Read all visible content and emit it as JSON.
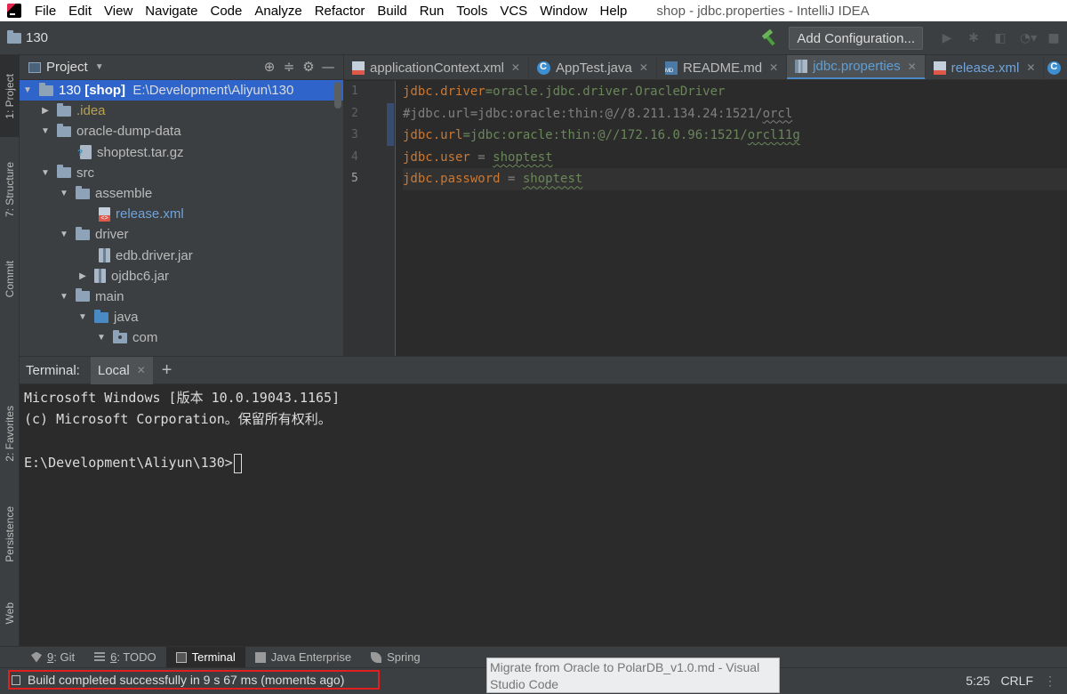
{
  "menubar": {
    "items": [
      "File",
      "Edit",
      "View",
      "Navigate",
      "Code",
      "Analyze",
      "Refactor",
      "Build",
      "Run",
      "Tools",
      "VCS",
      "Window",
      "Help"
    ],
    "window_title": "shop - jdbc.properties - IntelliJ IDEA"
  },
  "toolbar": {
    "project_name": "130",
    "add_config_label": "Add Configuration..."
  },
  "left_stripe": {
    "project": "1: Project",
    "structure": "7: Structure",
    "commit": "Commit",
    "favorites": "2: Favorites",
    "persistence": "Persistence",
    "web": "Web"
  },
  "project_panel": {
    "title": "Project",
    "tree": {
      "root_name": "130",
      "root_module": "[shop]",
      "root_path": "E:\\Development\\Aliyun\\130",
      "idea": ".idea",
      "oracle_dump": "oracle-dump-data",
      "shoptest": "shoptest.tar.gz",
      "src": "src",
      "assemble": "assemble",
      "release_xml": "release.xml",
      "driver": "driver",
      "edb_jar": "edb.driver.jar",
      "ojdbc_jar": "ojdbc6.jar",
      "main": "main",
      "java": "java",
      "com": "com"
    }
  },
  "editor": {
    "tabs": [
      {
        "label": "applicationContext.xml"
      },
      {
        "label": "AppTest.java"
      },
      {
        "label": "README.md"
      },
      {
        "label": "jdbc.properties"
      },
      {
        "label": "release.xml"
      }
    ],
    "line_numbers": [
      "1",
      "2",
      "3",
      "4",
      "5"
    ],
    "lines": {
      "l1_key": "jdbc.driver",
      "l1_eq": "=",
      "l1_val": "oracle.jdbc.driver.OracleDriver",
      "l2_comment_pre": "#jdbc.url=jdbc:oracle:thin:@//8.211.134.24:1521/",
      "l2_comment_ul": "orcl",
      "l3_key": "jdbc.url",
      "l3_eq": "=",
      "l3_val_pre": "jdbc:oracle:thin:@//172.16.0.96:1521/",
      "l3_val_ul": "orcl11g",
      "l4_key": "jdbc.user",
      "l4_eq": " = ",
      "l4_val": "shoptest",
      "l5_key": "jdbc.password",
      "l5_eq": " = ",
      "l5_val": "shoptest"
    }
  },
  "terminal": {
    "label": "Terminal:",
    "tab": "Local",
    "add": "+",
    "line1": "Microsoft Windows [版本 10.0.19043.1165]",
    "line2": "(c) Microsoft Corporation。保留所有权利。",
    "prompt": "E:\\Development\\Aliyun\\130>"
  },
  "bottom_tools": {
    "git_num": "9",
    "git_label": ": Git",
    "todo_num": "6",
    "todo_label": ": TODO",
    "terminal": "Terminal",
    "java_enterprise": "Java Enterprise",
    "spring": "Spring"
  },
  "statusbar": {
    "build_message": "Build completed successfully in 9 s 67 ms (moments ago)",
    "tooltip": "Migrate from Oracle to PolarDB_v1.0.md - Visual Studio Code",
    "caret_pos": "5:25",
    "line_sep": "CRLF"
  }
}
